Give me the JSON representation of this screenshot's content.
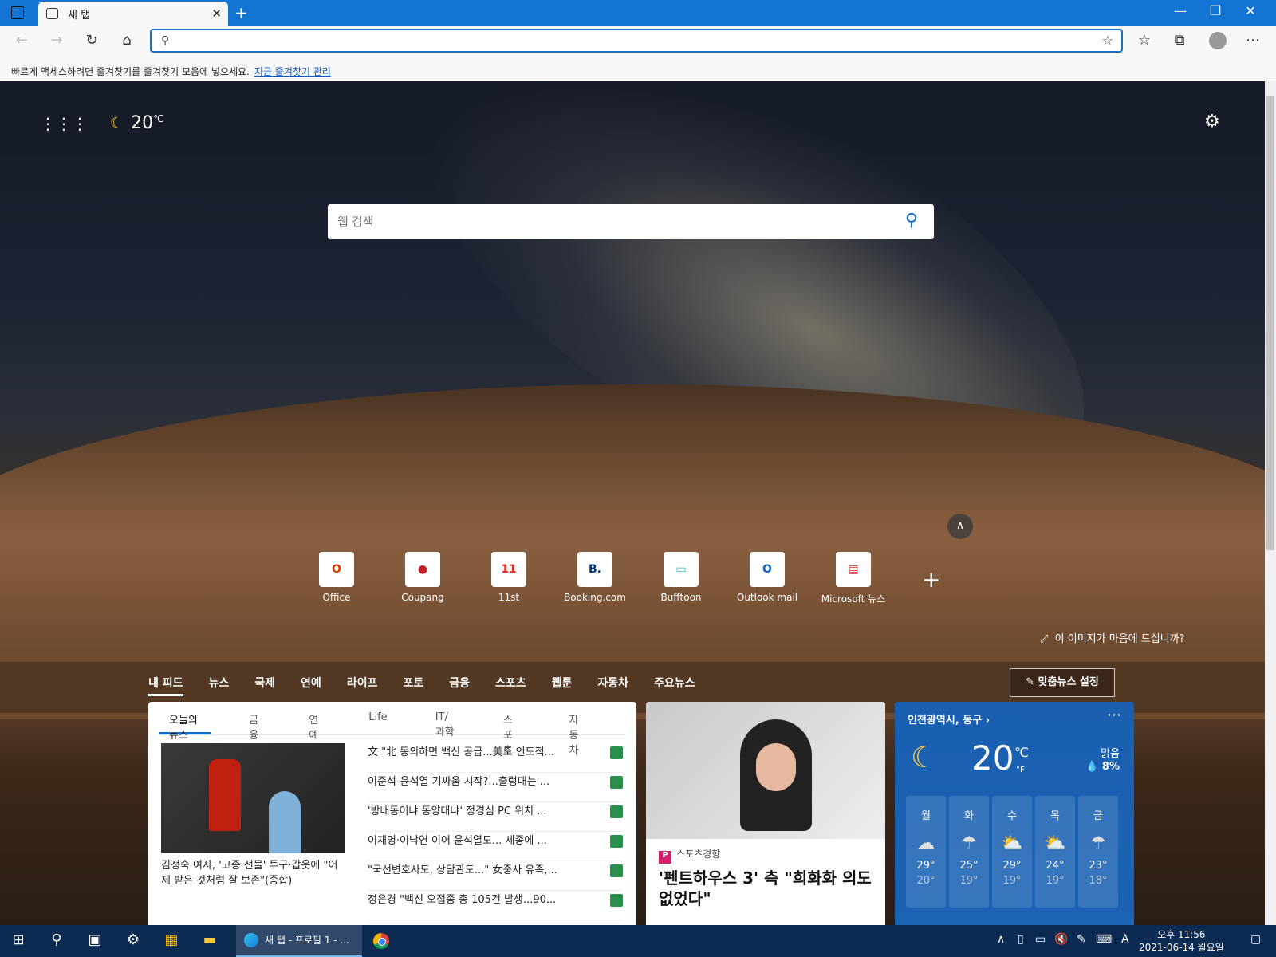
{
  "browser": {
    "tab_title": "새 탭",
    "new_tab": "+",
    "window_controls": [
      "—",
      "❐",
      "✕"
    ],
    "address_placeholder": "",
    "fav_hint": "빠르게 액세스하려면 즐겨찾기를 즐겨찾기 모음에 넣으세요.",
    "fav_link": "지금 즐겨찾기 관리"
  },
  "page": {
    "temperature": "20",
    "temp_unit": "℃",
    "search_placeholder": "웹 검색",
    "like_image": "이 이미지가 마음에 드십니까?",
    "quick_links": [
      {
        "label": "Office",
        "icon": "office-icon",
        "color": "#d83b01",
        "glyph": "O"
      },
      {
        "label": "Coupang",
        "icon": "coupang-icon",
        "color": "#c32026",
        "glyph": "●"
      },
      {
        "label": "11st",
        "icon": "11st-icon",
        "color": "#ee2e24",
        "glyph": "11"
      },
      {
        "label": "Booking.com",
        "icon": "booking-icon",
        "color": "#003580",
        "glyph": "B."
      },
      {
        "label": "Bufftoon",
        "icon": "bufftoon-icon",
        "color": "#22b8cf",
        "glyph": "▭"
      },
      {
        "label": "Outlook mail",
        "icon": "outlook-icon",
        "color": "#0a64c8",
        "glyph": "O"
      },
      {
        "label": "Microsoft 뉴스",
        "icon": "msnews-icon",
        "color": "#d9252b",
        "glyph": "▤"
      }
    ],
    "feed_tabs": [
      "내 피드",
      "뉴스",
      "국제",
      "연예",
      "라이프",
      "포토",
      "금융",
      "스포츠",
      "웹툰",
      "자동차",
      "주요뉴스"
    ],
    "personalize": "맞춤뉴스 설정"
  },
  "news": {
    "tabs": [
      "오늘의 뉴스",
      "금융",
      "연예",
      "Life",
      "IT/과학",
      "스포츠",
      "자동차"
    ],
    "main_caption": "김정숙 여사, '고종 선물' 투구·갑옷에 \"어제 받은 것처럼 잘 보존\"(종합)",
    "headlines": [
      "文 \"北 동의하면 백신 공급...美도 인도적...",
      "이준석-윤석열 기싸움 시작?...출렁대는 ...",
      "'방배동이냐 동양대냐' 정경심 PC 위치 ...",
      "이재명·이낙연 이어 윤석열도... 세종에 ...",
      "\"국선변호사도, 상담관도...\" 女중사 유족,...",
      "정은경 \"백신 오접종 총 105건 발생...90..."
    ]
  },
  "photo": {
    "source": "스포츠경향",
    "title": "'펜트하우스 3' 측 \"희화화 의도 없었다\""
  },
  "weather": {
    "location": "인천광역시, 동구",
    "temp": "20",
    "unit_c": "℃",
    "unit_f": "°F",
    "condition": "맑음",
    "precip": "💧 8%",
    "days": [
      {
        "d": "월",
        "hi": "29°",
        "lo": "20°",
        "icon": "cloud-icon"
      },
      {
        "d": "화",
        "hi": "25°",
        "lo": "19°",
        "icon": "rain-icon"
      },
      {
        "d": "수",
        "hi": "29°",
        "lo": "19°",
        "icon": "partly-sunny-icon"
      },
      {
        "d": "목",
        "hi": "24°",
        "lo": "19°",
        "icon": "sun-rain-icon"
      },
      {
        "d": "금",
        "hi": "23°",
        "lo": "18°",
        "icon": "rain-icon"
      }
    ]
  },
  "taskbar": {
    "app_label": "새 탭 - 프로필 1 - ...",
    "time": "오후 11:56",
    "date": "2021-06-14 월요일",
    "ime": "A"
  }
}
